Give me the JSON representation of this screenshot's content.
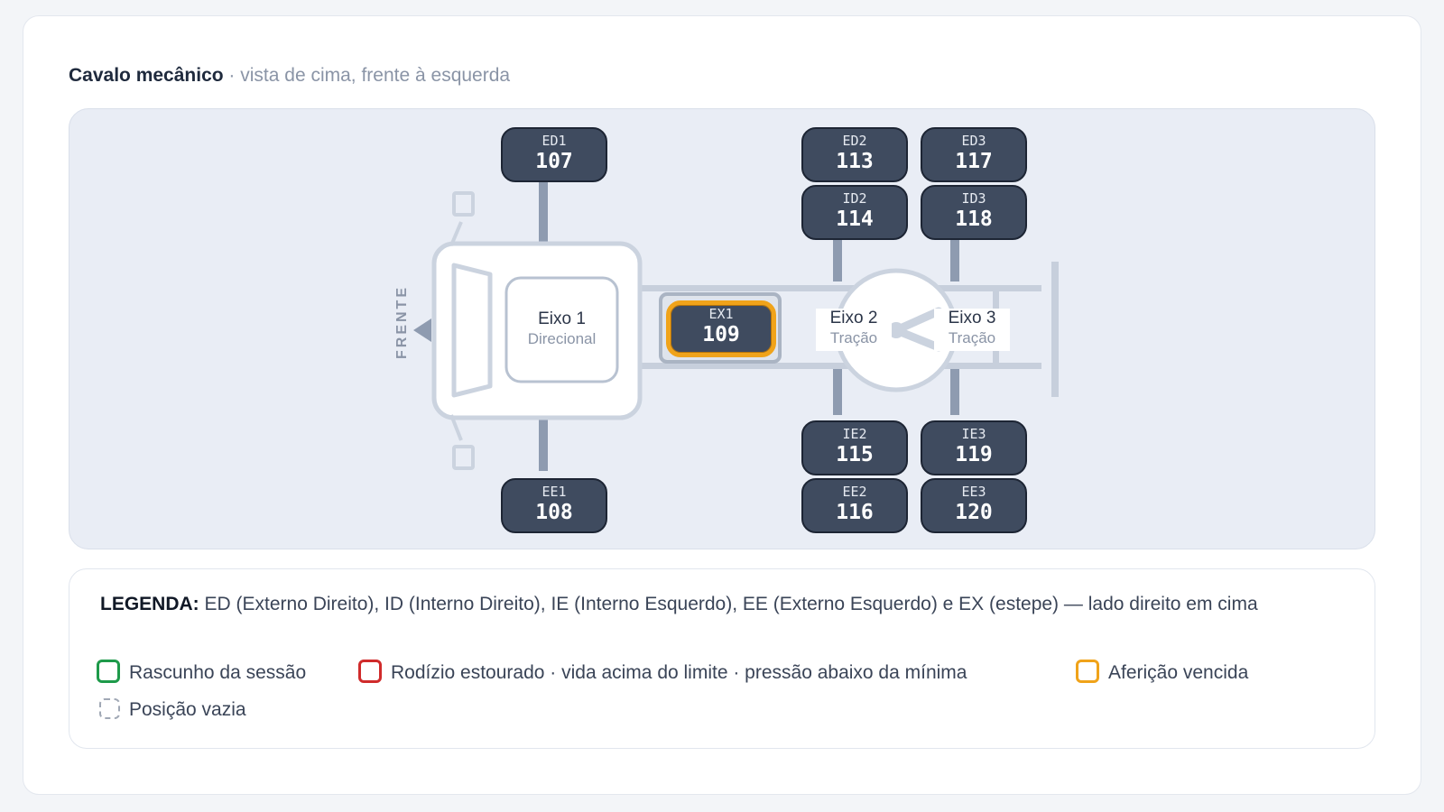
{
  "header": {
    "title": "Cavalo mecânico",
    "subtitle": " · vista de cima, frente à esquerda"
  },
  "diagram": {
    "front_label": "FRENTE",
    "axles": [
      {
        "name": "Eixo 1",
        "type": "Direcional"
      },
      {
        "name": "Eixo 2",
        "type": "Tração"
      },
      {
        "name": "Eixo 3",
        "type": "Tração"
      }
    ],
    "tires": [
      {
        "code": "ED1",
        "number": "107"
      },
      {
        "code": "EE1",
        "number": "108"
      },
      {
        "code": "EX1",
        "number": "109",
        "status": "afericao-vencida"
      },
      {
        "code": "ED2",
        "number": "113"
      },
      {
        "code": "ID2",
        "number": "114"
      },
      {
        "code": "IE2",
        "number": "115"
      },
      {
        "code": "EE2",
        "number": "116"
      },
      {
        "code": "ED3",
        "number": "117"
      },
      {
        "code": "ID3",
        "number": "118"
      },
      {
        "code": "IE3",
        "number": "119"
      },
      {
        "code": "EE3",
        "number": "120"
      }
    ]
  },
  "legend": {
    "heading": "LEGENDA:",
    "description": " ED (Externo Direito), ID (Interno Direito), IE (Interno Esquerdo), EE (Externo Esquerdo) e EX (estepe) — lado direito em cima",
    "items": [
      {
        "label": "Rascunho da sessão",
        "color": "#1e9a4a"
      },
      {
        "label": "Rodízio estourado · vida acima do limite · pressão abaixo da mínima",
        "color": "#d02b2b"
      },
      {
        "label": "Aferição vencida",
        "color": "#f0a31a"
      },
      {
        "label": "Posição vazia",
        "color": "#a0a8b5"
      }
    ]
  },
  "colors": {
    "tire_fill": "#3f4b5f",
    "tire_border": "#1d2534",
    "warning": "#f0a31a",
    "panel": "#e9edf5"
  }
}
